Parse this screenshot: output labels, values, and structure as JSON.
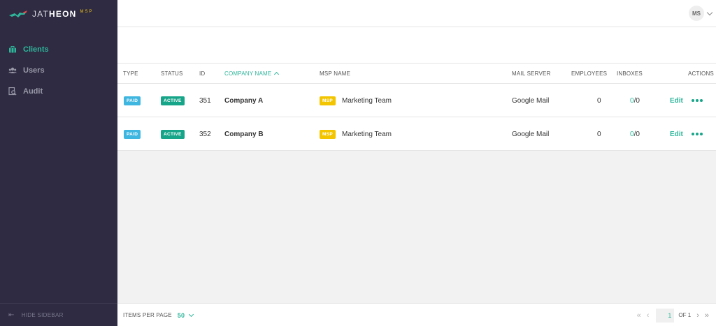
{
  "brand": {
    "name_light": "JAT",
    "name_bold": "HEON",
    "suffix": "MSP"
  },
  "sidebar": {
    "items": [
      {
        "label": "Clients",
        "icon": "briefcase-icon",
        "active": true
      },
      {
        "label": "Users",
        "icon": "users-icon",
        "active": false
      },
      {
        "label": "Audit",
        "icon": "audit-icon",
        "active": false
      }
    ],
    "hide_label": "HIDE SIDEBAR"
  },
  "topbar": {
    "avatar_initials": "MS"
  },
  "table": {
    "columns": [
      "TYPE",
      "STATUS",
      "ID",
      "COMPANY NAME",
      "MSP NAME",
      "MAIL SERVER",
      "EMPLOYEES",
      "INBOXES",
      "ACTIONS"
    ],
    "sorted_column": "COMPANY NAME",
    "rows": [
      {
        "type": "PAID",
        "status": "ACTIVE",
        "id": "351",
        "company": "Company A",
        "msp_badge": "MSP",
        "msp_name": "Marketing Team",
        "mail_server": "Google Mail",
        "employees": "0",
        "inboxes_active": "0",
        "inboxes_total": "/0",
        "edit": "Edit"
      },
      {
        "type": "PAID",
        "status": "ACTIVE",
        "id": "352",
        "company": "Company B",
        "msp_badge": "MSP",
        "msp_name": "Marketing Team",
        "mail_server": "Google Mail",
        "employees": "0",
        "inboxes_active": "0",
        "inboxes_total": "/0",
        "edit": "Edit"
      }
    ]
  },
  "footer": {
    "items_per_page_label": "ITEMS PER PAGE",
    "items_per_page_value": "50",
    "current_page": "1",
    "of_label": "OF 1"
  },
  "colors": {
    "sidebar_bg": "#2e2b42",
    "accent": "#2fb69b",
    "paid": "#3fb6e0",
    "active": "#17a589",
    "msp": "#f2c500"
  }
}
